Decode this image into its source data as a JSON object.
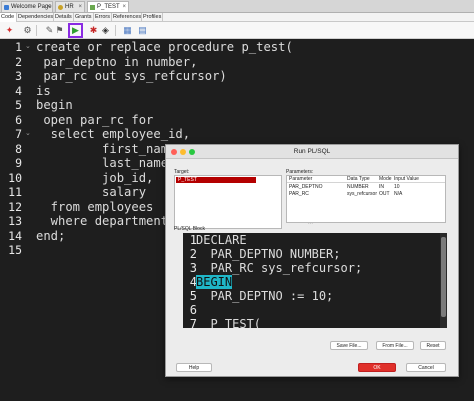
{
  "tabs": [
    {
      "label": "Welcome Page",
      "active": false
    },
    {
      "label": "HR",
      "active": false
    },
    {
      "label": "P_TEST",
      "active": true
    }
  ],
  "subtabs": [
    {
      "label": "Code",
      "active": true
    },
    {
      "label": "Dependencies",
      "active": false
    },
    {
      "label": "Details",
      "active": false
    },
    {
      "label": "Grants",
      "active": false
    },
    {
      "label": "Errors",
      "active": false
    },
    {
      "label": "References",
      "active": false
    },
    {
      "label": "Profiles",
      "active": false
    }
  ],
  "toolbar": {
    "icons": [
      "pin-icon",
      "compile-icon",
      "run-icon",
      "debug-icon",
      "breakpoints-icon",
      "bookmark-icon",
      "profile-icon"
    ]
  },
  "editor": {
    "line_numbers": [
      "1",
      "2",
      "3",
      "4",
      "5",
      "6",
      "7",
      "8",
      "9",
      "10",
      "11",
      "12",
      "13",
      "14",
      "15"
    ],
    "lines": [
      "create or replace procedure p_test(",
      " par_deptno in number,",
      " par_rc out sys_refcursor)",
      "is",
      "begin",
      " open par_rc for",
      "  select employee_id,",
      "         first_name,",
      "         last_name,",
      "         job_id,",
      "         salary",
      "  from employees",
      "  where department_i",
      "end;",
      ""
    ]
  },
  "dialog": {
    "title": "Run PL/SQL",
    "target_label": "Target:",
    "targets": [
      "P_TEST"
    ],
    "parameters_label": "Parameters:",
    "param_headers": [
      "Parameter",
      "Data Type",
      "Mode",
      "Input Value"
    ],
    "params": [
      [
        "PAR_DEPTNO",
        "NUMBER",
        "IN",
        "10"
      ],
      [
        "PAR_RC",
        "sys_refcursor",
        "OUT",
        "N/A"
      ]
    ],
    "block_label": "PL/SQL Block",
    "block_line_numbers": [
      "1",
      "2",
      "3",
      "4",
      "5",
      "6",
      "7"
    ],
    "block_lines": [
      "DECLARE",
      "  PAR_DEPTNO NUMBER;",
      "  PAR_RC sys_refcursor;",
      "BEGIN",
      "  PAR_DEPTNO := 10;",
      "",
      "  P_TEST("
    ],
    "buttons": {
      "save_file": "Save File...",
      "from_file": "From File...",
      "reset": "Reset",
      "help": "Help",
      "ok": "OK",
      "cancel": "Cancel"
    }
  },
  "colors": {
    "editor_bg": "#1e1e1e",
    "highlight": "#1fb6c7",
    "target_selected": "#b40000",
    "ok_button": "#e0302a",
    "run_button_frame": "#8a2be2"
  }
}
